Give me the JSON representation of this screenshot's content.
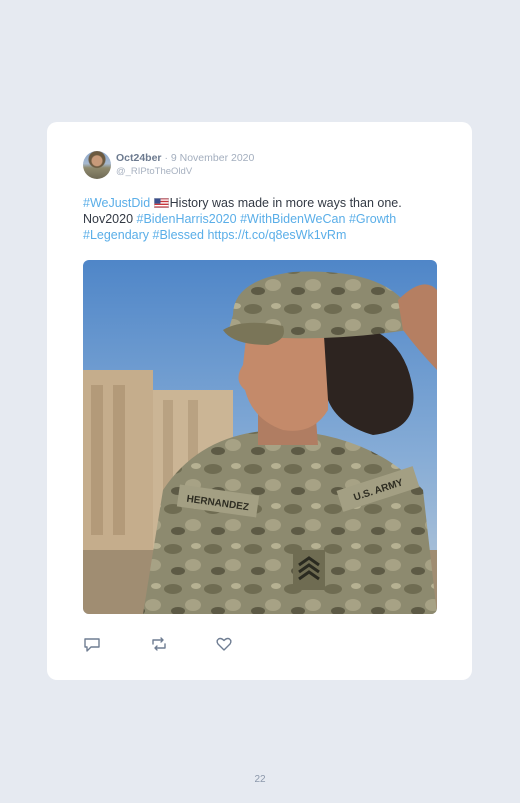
{
  "tweet": {
    "display_name": "Oct24ber",
    "separator": "·",
    "date": "9 November 2020",
    "handle": "@_RIPtoTheOldV",
    "text": {
      "tag1": "#WeJustDid",
      "flag_icon": "us-flag-icon",
      "plain1": "History was made in more ways than one. Nov2020 ",
      "tag2": "#BidenHarris2020",
      "tag3": "#WithBidenWeCan",
      "tag4": "#Growth",
      "tag5": "#Legendary",
      "tag6": "#Blessed",
      "link": "https://t.co/q8esWk1vRm"
    },
    "photo": {
      "name_tape": "HERNANDEZ",
      "branch_tape": "U.S. ARMY"
    },
    "actions": [
      "reply-icon",
      "retweet-icon",
      "like-icon"
    ]
  },
  "colors": {
    "background": "#e6eaf1",
    "card": "#ffffff",
    "hashtag": "#5aaee8",
    "text": "#333a45",
    "meta": "#a3aebe"
  },
  "page": {
    "number": "22"
  }
}
